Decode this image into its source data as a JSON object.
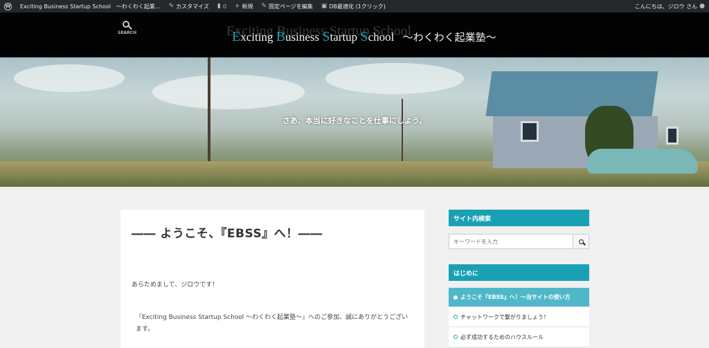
{
  "adminbar": {
    "site_name": "Exciting Business Startup School　〜わくわく起業...",
    "customize": "カスタマイズ",
    "comments": "0",
    "new": "新規",
    "edit_page": "固定ページを編集",
    "db_optimize": "DB最適化 (1クリック)",
    "greeting": "こんにちは、ジロウ さん"
  },
  "header": {
    "search_label": "SEARCH",
    "logo": {
      "shadow": "Exciting Business Startup School",
      "w1_initial": "E",
      "w1_rest": "xciting",
      "w2_initial": "B",
      "w2_rest": "usiness",
      "w3_initial": "S",
      "w3_rest": "tartup",
      "w4_initial": "S",
      "w4_rest": "chool",
      "jp": "〜わくわく起業塾〜"
    },
    "accent": "#1aa0b4"
  },
  "hero": {
    "tagline": "さあ、本当に好きなことを仕事にしよう。"
  },
  "article": {
    "title": "―― ようこそ、『EBSS』へ！――",
    "p1": "あらためまして、ジロウです！",
    "p2": "『Exciting Business Startup School 〜わくわく起業塾〜』へのご参加、誠にありがとうございます。"
  },
  "sidebar": {
    "search_title": "サイト内検索",
    "search_placeholder": "キーワードを入力",
    "intro_title": "はじめに",
    "items": [
      {
        "label": "ようこそ『EBSS』へ！〜当サイトの使い方"
      },
      {
        "label": "チャットワークで繋がりましょう！"
      },
      {
        "label": "必ず成功するためのハウスルール"
      }
    ]
  }
}
